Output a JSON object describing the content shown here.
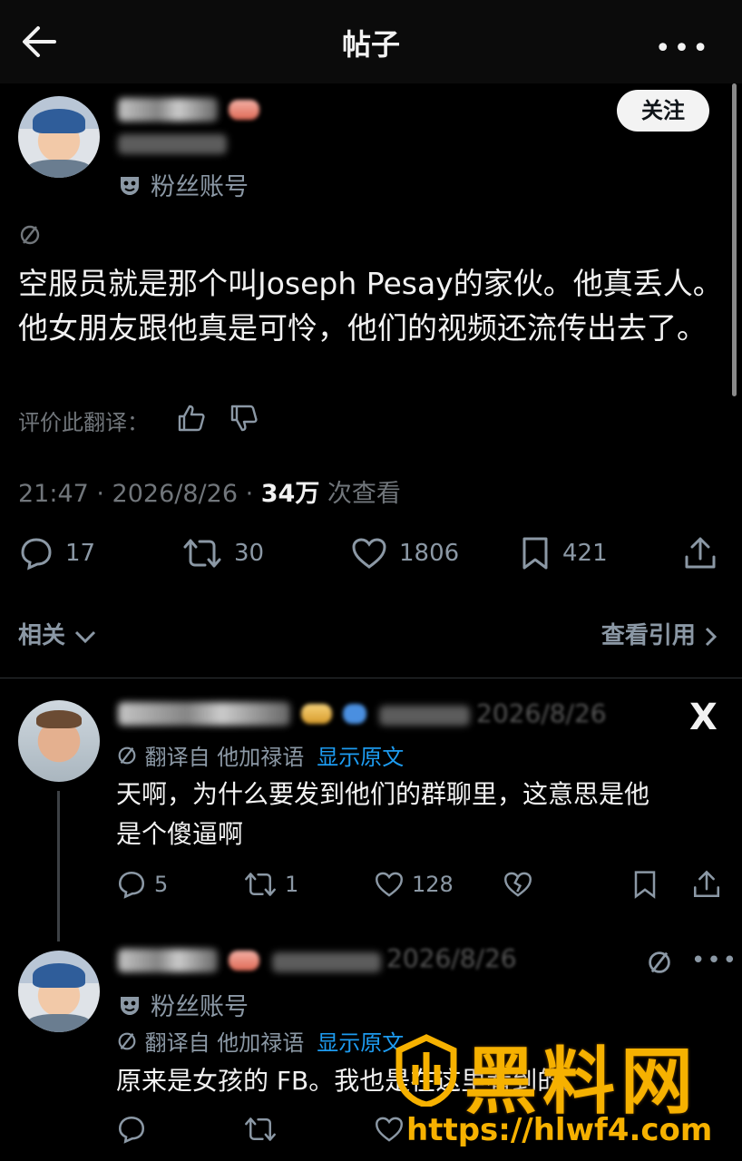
{
  "header": {
    "title": "帖子",
    "more_label": "•••"
  },
  "post": {
    "follow_label": "关注",
    "fan_label": "粉丝账号",
    "text": "空服员就是那个叫Joseph Pesay的家伙。他真丢人。他女朋友跟他真是可怜，他们的视频还流传出去了。",
    "rate_label": "评价此翻译：",
    "time": "21:47 · 2026/8/26 · ",
    "views_count": "34万",
    "views_suffix": " 次查看",
    "replies": "17",
    "reposts": "30",
    "likes": "1806",
    "bookmarks": "421"
  },
  "section": {
    "related_label": "相关",
    "quotes_label": "查看引用"
  },
  "replies": [
    {
      "date": "2026/8/26",
      "translated_from": "翻译自 他加禄语",
      "show_original": "显示原文",
      "text_line1": "天啊，为什么要发到他们的群聊里，这意思是他",
      "text_line2": "是个傻逼啊",
      "replies": "5",
      "reposts": "1",
      "likes": "128",
      "x_logo": "X"
    },
    {
      "date": "2026/8/26",
      "fan_label": "粉丝账号",
      "translated_from": "翻译自 他加禄语",
      "show_original": "显示原文",
      "text": "原来是女孩的 FB。我也是在这里看到的。",
      "more_label": "•••"
    }
  ],
  "watermark": {
    "brand": "黑料网",
    "url": "https://hlwf4.com"
  }
}
